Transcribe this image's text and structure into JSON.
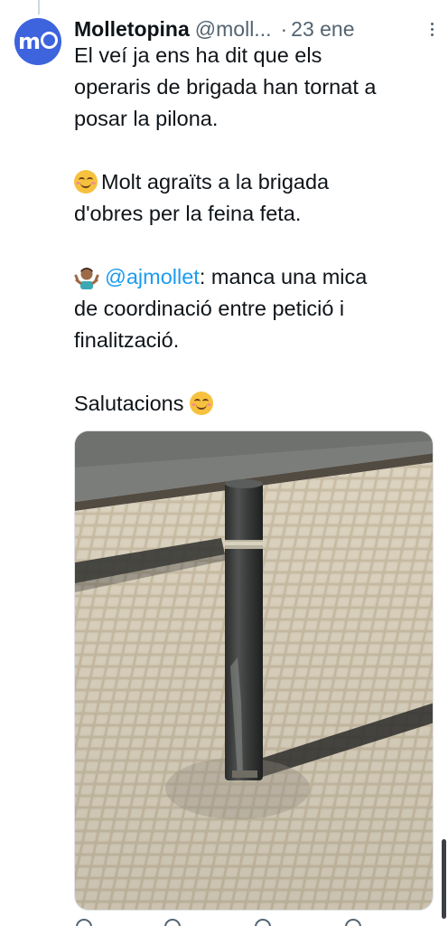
{
  "author": {
    "display_name": "Molletopina",
    "handle": "@moll...",
    "separator": "·",
    "date": "23 ene"
  },
  "tweet": {
    "line1": "El veí ja ens ha dit que els",
    "line2": "operaris de brigada han tornat a",
    "line3": "posar la pilona.",
    "p2_line1": "Molt agraïts a la brigada",
    "p2_line2": "d'obres per la feina feta.",
    "mention": "@ajmollet",
    "p3_line1_rest": ": manca una mica",
    "p3_line2": "de coordinació entre petició i",
    "p3_line3": "finalització.",
    "closing": "Salutacions"
  },
  "icons": {
    "avatar": "molletopina-logo",
    "more": "more-vertical-icon",
    "smile": "smiling-face-emoji",
    "shrug": "person-shrugging-emoji"
  },
  "colors": {
    "link": "#1d9bf0",
    "avatar_bg": "#3d63dd",
    "secondary_text": "#536471"
  }
}
